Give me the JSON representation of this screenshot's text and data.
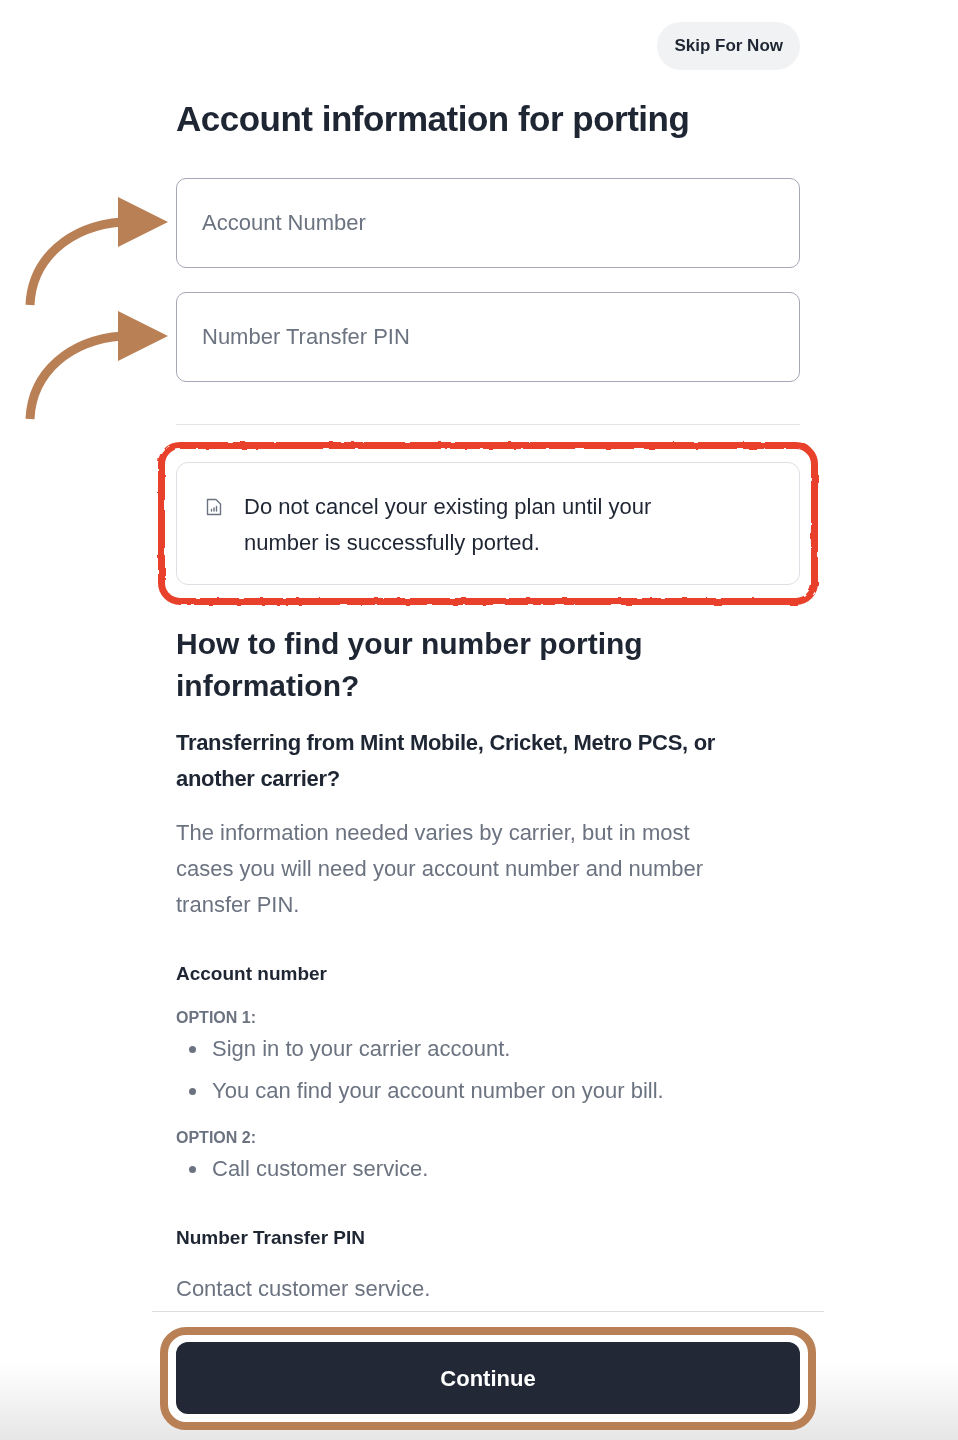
{
  "header": {
    "skip_button": "Skip For Now"
  },
  "title": "Account information for porting",
  "fields": [
    {
      "placeholder": "Account Number"
    },
    {
      "placeholder": "Number Transfer PIN"
    }
  ],
  "notice": {
    "text": "Do not cancel your existing plan until your number is successfully ported."
  },
  "help": {
    "heading": "How to find your number porting information?",
    "subheading": "Transferring from Mint Mobile, Cricket, Metro PCS, or another carrier?",
    "intro": "The information needed varies by carrier, but in most cases you will need your account number and number transfer PIN.",
    "sections": [
      {
        "title": "Account number",
        "options": [
          {
            "label": "OPTION 1:",
            "items": [
              "Sign in to your carrier account.",
              "You can find your account number on your bill."
            ]
          },
          {
            "label": "OPTION 2:",
            "items": [
              "Call customer service."
            ]
          }
        ]
      },
      {
        "title": "Number Transfer PIN",
        "text": "Contact customer service."
      }
    ]
  },
  "footer": {
    "button": "Continue"
  }
}
